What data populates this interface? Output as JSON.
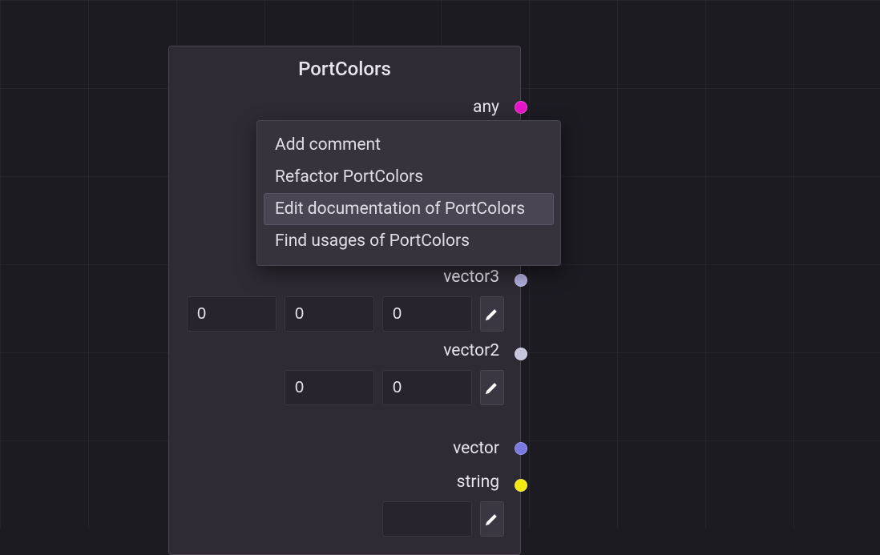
{
  "node": {
    "title": "PortColors",
    "ports": {
      "any": {
        "label": "any",
        "color": "#e815c9"
      },
      "vector3": {
        "label": "vector3",
        "color": "#b0aee0",
        "values": [
          "0",
          "0",
          "0"
        ]
      },
      "vector2": {
        "label": "vector2",
        "color": "#c8c6dc",
        "values": [
          "0",
          "0"
        ]
      },
      "vector": {
        "label": "vector",
        "color": "#7a79e0"
      },
      "string": {
        "label": "string",
        "color": "#f3e813",
        "value": ""
      }
    }
  },
  "contextMenu": {
    "items": [
      {
        "label": "Add comment",
        "highlighted": false
      },
      {
        "label": "Refactor PortColors",
        "highlighted": false
      },
      {
        "label": "Edit documentation of PortColors",
        "highlighted": true
      },
      {
        "label": "Find usages of PortColors",
        "highlighted": false
      }
    ]
  }
}
